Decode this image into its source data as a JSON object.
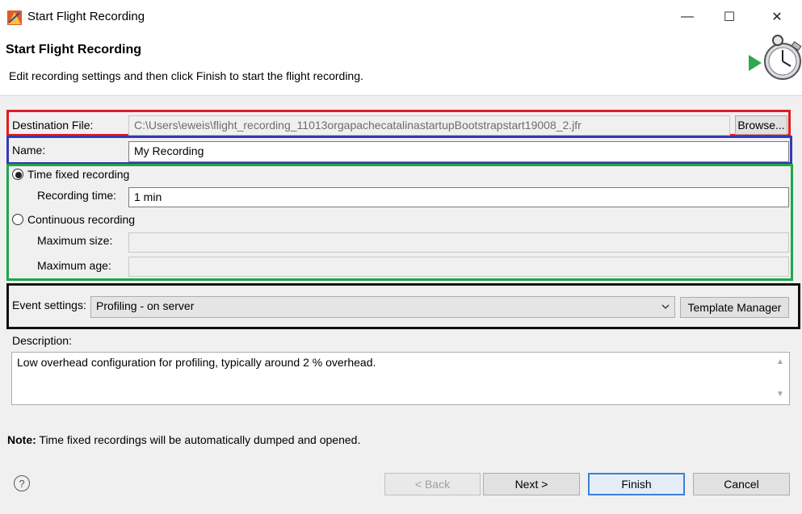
{
  "window": {
    "title": "Start Flight Recording",
    "controls": {
      "minimize": "—",
      "maximize": "☐",
      "close": "✕"
    }
  },
  "header": {
    "title": "Start Flight Recording",
    "description": "Edit recording settings and then click Finish to start the flight recording."
  },
  "destination": {
    "label": "Destination File:",
    "value": "C:\\Users\\eweis\\flight_recording_11013orgapachecatalinastartupBootstrapstart19008_2.jfr",
    "browse_label": "Browse..."
  },
  "name": {
    "label": "Name:",
    "value": "My Recording"
  },
  "recording_mode": {
    "time_fixed_label": "Time fixed recording",
    "time_fixed_selected": true,
    "recording_time_label": "Recording time:",
    "recording_time_value": "1 min",
    "continuous_label": "Continuous recording",
    "continuous_selected": false,
    "max_size_label": "Maximum size:",
    "max_size_value": "",
    "max_age_label": "Maximum age:",
    "max_age_value": ""
  },
  "event_settings": {
    "label": "Event settings:",
    "selected": "Profiling - on server",
    "template_manager_label": "Template Manager"
  },
  "description": {
    "label": "Description:",
    "text": "Low overhead configuration for profiling, typically around 2 % overhead."
  },
  "note": {
    "bold": "Note:",
    "text": " Time fixed recordings will be automatically dumped and opened."
  },
  "footer": {
    "help": "?",
    "back_label": "< Back",
    "next_label": "Next >",
    "finish_label": "Finish",
    "cancel_label": "Cancel"
  },
  "colors": {
    "destination_outline": "#e11d21",
    "name_outline": "#3338b8",
    "recording_outline": "#1fa64a",
    "event_outline": "#111111",
    "finish_focus": "#3c7fd7"
  }
}
